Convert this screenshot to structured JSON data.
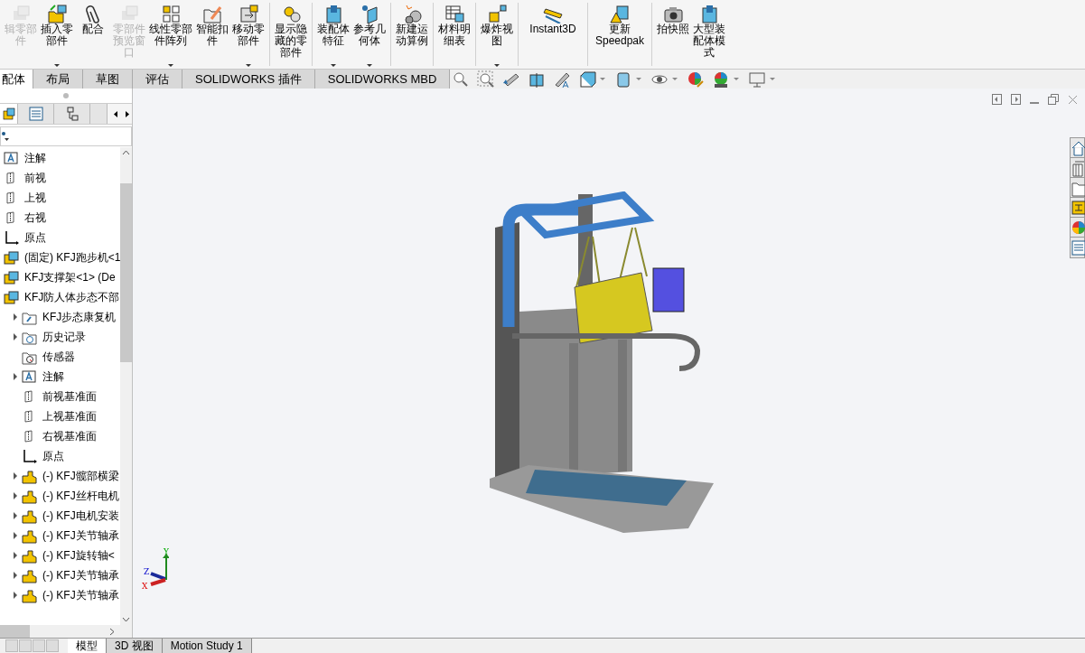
{
  "toolbar": {
    "groups": [
      [
        {
          "label": "辑零部件",
          "disabled": true,
          "has_menu": false
        },
        {
          "label": "插入零部件",
          "disabled": false,
          "has_menu": true
        },
        {
          "label": "配合",
          "disabled": false,
          "has_menu": false
        },
        {
          "label": "零部件预览窗口",
          "disabled": true,
          "has_menu": false
        },
        {
          "label": "线性零部件阵列",
          "disabled": false,
          "has_menu": true
        },
        {
          "label": "智能扣件",
          "disabled": false,
          "has_menu": false
        },
        {
          "label": "移动零部件",
          "disabled": false,
          "has_menu": true
        }
      ],
      [
        {
          "label": "显示隐藏的零部件",
          "disabled": false,
          "has_menu": false
        }
      ],
      [
        {
          "label": "装配体特征",
          "disabled": false,
          "has_menu": true
        },
        {
          "label": "参考几何体",
          "disabled": false,
          "has_menu": true
        }
      ],
      [
        {
          "label": "新建运动算例",
          "disabled": false,
          "has_menu": false
        }
      ],
      [
        {
          "label": "材料明细表",
          "disabled": false,
          "has_menu": false
        }
      ],
      [
        {
          "label": "爆炸视图",
          "disabled": false,
          "has_menu": true
        }
      ],
      [
        {
          "label": "Instant3D",
          "disabled": false,
          "has_menu": false
        }
      ],
      [
        {
          "label": "更新 Speedpak",
          "disabled": false,
          "has_menu": false
        }
      ],
      [
        {
          "label": "拍快照",
          "disabled": false,
          "has_menu": false
        },
        {
          "label": "大型装配体模式",
          "disabled": false,
          "has_menu": false
        }
      ]
    ]
  },
  "command_tabs": [
    {
      "label": "配体",
      "selected": true
    },
    {
      "label": "布局",
      "selected": false
    },
    {
      "label": "草图",
      "selected": false
    },
    {
      "label": "评估",
      "selected": false
    },
    {
      "label": "SOLIDWORKS 插件",
      "selected": false
    },
    {
      "label": "SOLIDWORKS MBD",
      "selected": false
    }
  ],
  "tree": [
    {
      "kind": "annotation",
      "label": "注解",
      "expandable": false
    },
    {
      "kind": "plane",
      "label": "前视",
      "expandable": false
    },
    {
      "kind": "plane",
      "label": "上视",
      "expandable": false
    },
    {
      "kind": "plane",
      "label": "右视",
      "expandable": false
    },
    {
      "kind": "origin",
      "label": "原点",
      "expandable": false
    },
    {
      "kind": "assembly",
      "label": "(固定) KFJ跑步机<1",
      "expandable": false
    },
    {
      "kind": "assembly",
      "label": "KFJ支撑架<1> (De",
      "expandable": false
    },
    {
      "kind": "assembly",
      "label": "KFJ防人体步态不部",
      "expandable": false,
      "children": [
        {
          "kind": "mates",
          "label": "KFJ步态康复机",
          "expandable": true
        },
        {
          "kind": "history",
          "label": "历史记录",
          "expandable": true
        },
        {
          "kind": "sensor",
          "label": "传感器",
          "expandable": false
        },
        {
          "kind": "annotation",
          "label": "注解",
          "expandable": true
        },
        {
          "kind": "plane",
          "label": "前视基准面",
          "expandable": false
        },
        {
          "kind": "plane",
          "label": "上视基准面",
          "expandable": false
        },
        {
          "kind": "plane",
          "label": "右视基准面",
          "expandable": false
        },
        {
          "kind": "origin",
          "label": "原点",
          "expandable": false
        },
        {
          "kind": "part",
          "label": "(-) KFJ髋部横梁",
          "expandable": true
        },
        {
          "kind": "part",
          "label": "(-) KFJ丝杆电机",
          "expandable": true
        },
        {
          "kind": "part",
          "label": "(-) KFJ电机安装",
          "expandable": true
        },
        {
          "kind": "part",
          "label": "(-) KFJ关节轴承",
          "expandable": true
        },
        {
          "kind": "part",
          "label": "(-) KFJ旋转轴<",
          "expandable": true
        },
        {
          "kind": "part",
          "label": "(-) KFJ关节轴承",
          "expandable": true
        },
        {
          "kind": "part",
          "label": "(-) KFJ关节轴承",
          "expandable": true
        }
      ]
    }
  ],
  "triad": {
    "y": "Y",
    "z": "Z",
    "x": "X"
  },
  "bottom_tabs": [
    {
      "label": "模型",
      "selected": true
    },
    {
      "label": "3D 视图",
      "selected": false
    },
    {
      "label": "Motion Study 1",
      "selected": false
    }
  ]
}
